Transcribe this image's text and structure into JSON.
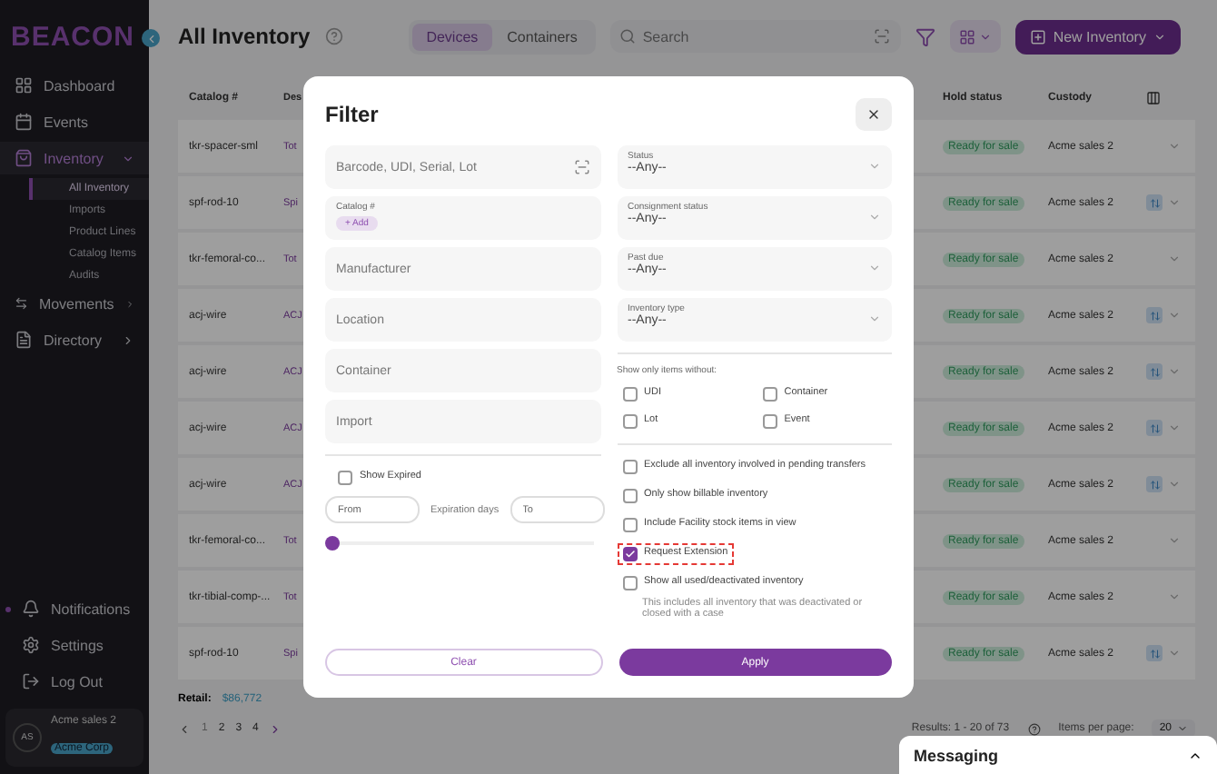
{
  "logo": "BEACON",
  "nav": [
    {
      "label": "Dashboard",
      "selected": false
    },
    {
      "label": "Events",
      "selected": false
    },
    {
      "label": "Inventory",
      "selected": true,
      "expanded": true,
      "children": [
        {
          "label": "All Inventory",
          "selected": true
        },
        {
          "label": "Imports",
          "selected": false
        },
        {
          "label": "Product Lines",
          "selected": false
        },
        {
          "label": "Catalog Items",
          "selected": false
        },
        {
          "label": "Audits",
          "selected": false
        }
      ]
    },
    {
      "label": "Movements",
      "selected": false,
      "expanded": false
    },
    {
      "label": "Directory",
      "selected": false,
      "expanded": false
    }
  ],
  "bottom_nav": [
    {
      "label": "Notifications",
      "unread": true
    },
    {
      "label": "Settings",
      "unread": false
    },
    {
      "label": "Log Out",
      "unread": false
    }
  ],
  "user": {
    "initials": "AS",
    "name": "Acme sales 2",
    "org": "Acme Corp"
  },
  "page_title": "All Inventory",
  "tabs": [
    {
      "label": "Devices",
      "selected": true
    },
    {
      "label": "Containers",
      "selected": false
    }
  ],
  "search": {
    "placeholder": "Search"
  },
  "new_button": "New Inventory",
  "table": {
    "columns": [
      "Catalog #",
      "Des",
      "Hold status",
      "Custody"
    ],
    "rows": [
      {
        "catalog": "tkr-spacer-sml",
        "desc": "Tot",
        "hold": "Ready for sale",
        "custody": "Acme sales 2",
        "transfer": false
      },
      {
        "catalog": "spf-rod-10",
        "desc": "Spi",
        "hold": "Ready for sale",
        "custody": "Acme sales 2",
        "transfer": true
      },
      {
        "catalog": "tkr-femoral-co...",
        "desc": "Tot",
        "hold": "Ready for sale",
        "custody": "Acme sales 2",
        "transfer": false
      },
      {
        "catalog": "acj-wire",
        "desc": "ACJ",
        "hold": "Ready for sale",
        "custody": "Acme sales 2",
        "transfer": true
      },
      {
        "catalog": "acj-wire",
        "desc": "ACJ",
        "hold": "Ready for sale",
        "custody": "Acme sales 2",
        "transfer": true
      },
      {
        "catalog": "acj-wire",
        "desc": "ACJ",
        "hold": "Ready for sale",
        "custody": "Acme sales 2",
        "transfer": true
      },
      {
        "catalog": "acj-wire",
        "desc": "ACJ",
        "hold": "Ready for sale",
        "custody": "Acme sales 2",
        "transfer": true
      },
      {
        "catalog": "tkr-femoral-co...",
        "desc": "Tot",
        "hold": "Ready for sale",
        "custody": "Acme sales 2",
        "transfer": false
      },
      {
        "catalog": "tkr-tibial-comp-...",
        "desc": "Tot",
        "hold": "Ready for sale",
        "custody": "Acme sales 2",
        "transfer": false
      },
      {
        "catalog": "spf-rod-10",
        "desc": "Spi",
        "hold": "Ready for sale",
        "custody": "Acme sales 2",
        "transfer": true
      }
    ]
  },
  "retail": {
    "label": "Retail:",
    "value": "$86,772"
  },
  "pages": [
    {
      "label": "1",
      "selected": true
    },
    {
      "label": "2",
      "selected": false
    },
    {
      "label": "3",
      "selected": false
    },
    {
      "label": "4",
      "selected": false
    }
  ],
  "results": "Results: 1 - 20 of 73",
  "per_page": {
    "label": "Items per page:",
    "value": "20"
  },
  "messaging": "Messaging",
  "filter": {
    "title": "Filter",
    "barcode": {
      "placeholder": "Barcode, UDI, Serial, Lot"
    },
    "catalog": {
      "label": "Catalog #",
      "add": "+ Add"
    },
    "fields": [
      {
        "placeholder": "Manufacturer"
      },
      {
        "placeholder": "Location"
      },
      {
        "placeholder": "Container"
      },
      {
        "placeholder": "Import"
      }
    ],
    "show_expired": {
      "label": "Show Expired",
      "checked": false
    },
    "expiration": {
      "from": {
        "placeholder": "From"
      },
      "label": "Expiration days",
      "to": {
        "placeholder": "To"
      },
      "level": 0
    },
    "selects": [
      {
        "label": "Status",
        "value": "--Any--"
      },
      {
        "label": "Consignment status",
        "value": "--Any--"
      },
      {
        "label": "Past due",
        "value": "--Any--"
      },
      {
        "label": "Inventory type",
        "value": "--Any--"
      }
    ],
    "without_label": "Show only items without:",
    "without": [
      {
        "label": "UDI",
        "checked": false
      },
      {
        "label": "Container",
        "checked": false
      },
      {
        "label": "Lot",
        "checked": false
      },
      {
        "label": "Event",
        "checked": false
      }
    ],
    "options": [
      {
        "label": "Exclude all inventory involved in pending transfers",
        "checked": false,
        "highlighted": false
      },
      {
        "label": "Only show billable inventory",
        "checked": false,
        "highlighted": false
      },
      {
        "label": "Include Facility stock items in view",
        "checked": false,
        "highlighted": false
      },
      {
        "label": "Request Extension",
        "checked": true,
        "highlighted": true
      },
      {
        "label": "Show all used/deactivated inventory",
        "checked": false,
        "highlighted": false,
        "note": "This includes all inventory that was deactivated or closed with a case"
      }
    ],
    "clear": "Clear",
    "apply": "Apply"
  }
}
